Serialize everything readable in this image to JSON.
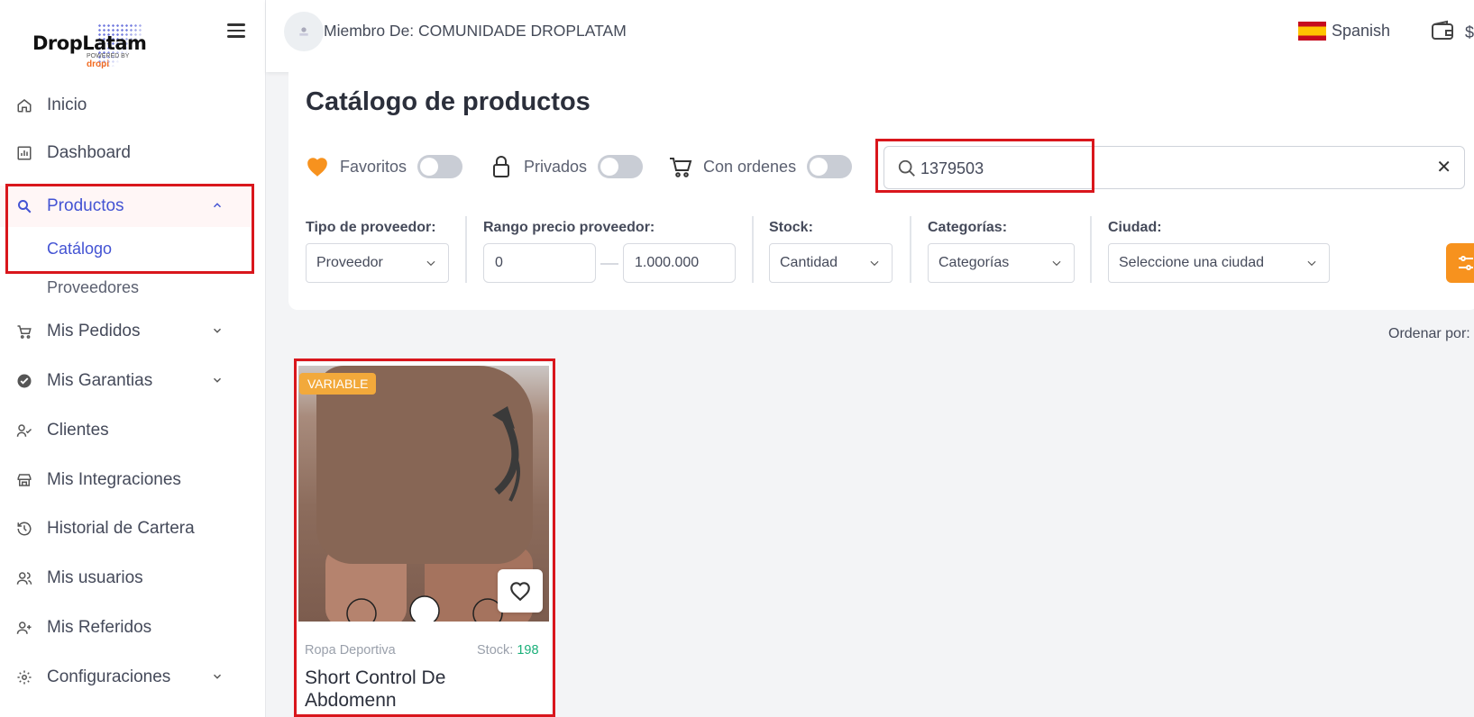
{
  "app": {
    "logo_text": "DropLatam",
    "logo_powered": "POWERED BY",
    "logo_brand": "dropi"
  },
  "sidebar": {
    "items": [
      {
        "label": "Inicio",
        "icon": "home-icon"
      },
      {
        "label": "Dashboard",
        "icon": "chart-icon"
      },
      {
        "label": "Productos",
        "icon": "search-icon",
        "expanded": true
      },
      {
        "label": "Mis Pedidos",
        "icon": "cart-icon"
      },
      {
        "label": "Mis Garantias",
        "icon": "badge-check-icon"
      },
      {
        "label": "Clientes",
        "icon": "user-check-icon"
      },
      {
        "label": "Mis Integraciones",
        "icon": "store-icon"
      },
      {
        "label": "Historial de Cartera",
        "icon": "history-icon"
      },
      {
        "label": "Mis usuarios",
        "icon": "users-icon"
      },
      {
        "label": "Mis Referidos",
        "icon": "user-plus-icon"
      },
      {
        "label": "Configuraciones",
        "icon": "gear-icon"
      }
    ],
    "sub_items": [
      {
        "label": "Catálogo",
        "active": true
      },
      {
        "label": "Proveedores",
        "active": false
      }
    ]
  },
  "header": {
    "member": "Miembro De: COMUNIDADE DROPLATAM",
    "language": "Spanish",
    "currency_symbol": "$"
  },
  "catalog": {
    "title": "Catálogo de productos",
    "toggles": {
      "favorites": "Favoritos",
      "private": "Privados",
      "with_orders": "Con ordenes"
    },
    "search": {
      "value": "1379503",
      "placeholder": "Buscar"
    },
    "filters": {
      "supplier_type_label": "Tipo de proveedor:",
      "supplier_type_value": "Proveedor",
      "price_range_label": "Rango precio proveedor:",
      "price_min": "0",
      "price_max": "1.000.000",
      "stock_label": "Stock:",
      "stock_value": "Cantidad",
      "categories_label": "Categorías:",
      "categories_value": "Categorías",
      "city_label": "Ciudad:",
      "city_value": "Seleccione una ciudad"
    },
    "order_by": "Ordenar por:"
  },
  "products": [
    {
      "badge": "VARIABLE",
      "category": "Ropa Deportiva",
      "stock_label": "Stock:",
      "stock": "198",
      "name": "Short Control De Abdomenn"
    }
  ],
  "colors": {
    "accent": "#4353d3",
    "orange": "#f7921e",
    "highlight": "#d9161c",
    "stock_green": "#1bb07a"
  }
}
